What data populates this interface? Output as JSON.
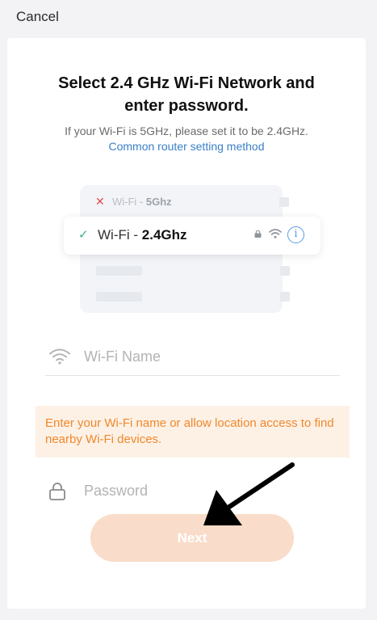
{
  "header": {
    "cancel_label": "Cancel"
  },
  "title": {
    "line1": "Select 2.4 GHz Wi-Fi Network and",
    "line2": "enter password."
  },
  "subtitle": "If your Wi-Fi is 5GHz, please set it to be 2.4GHz.",
  "router_link": "Common router setting method",
  "illustration": {
    "bad_network_prefix": "Wi-Fi - ",
    "bad_network_band": "5Ghz",
    "good_network_prefix": "Wi-Fi - ",
    "good_network_band": "2.4Ghz",
    "bad_mark": "✕",
    "good_mark": "✓",
    "info_glyph": "i"
  },
  "wifi_field": {
    "placeholder": "Wi-Fi Name",
    "value": "",
    "icon": "wifi-icon"
  },
  "warning": "Enter your Wi-Fi name or allow location access to find nearby Wi-Fi devices.",
  "password_field": {
    "placeholder": "Password",
    "value": "",
    "icon": "lock-icon"
  },
  "next_label": "Next",
  "colors": {
    "accent_orange": "#f0882b",
    "warning_bg": "#fdf1e6",
    "button_disabled": "#f9dcc9",
    "link_blue": "#3a7fc9",
    "check_green": "#3fae8e",
    "error_red": "#e24a4a"
  }
}
